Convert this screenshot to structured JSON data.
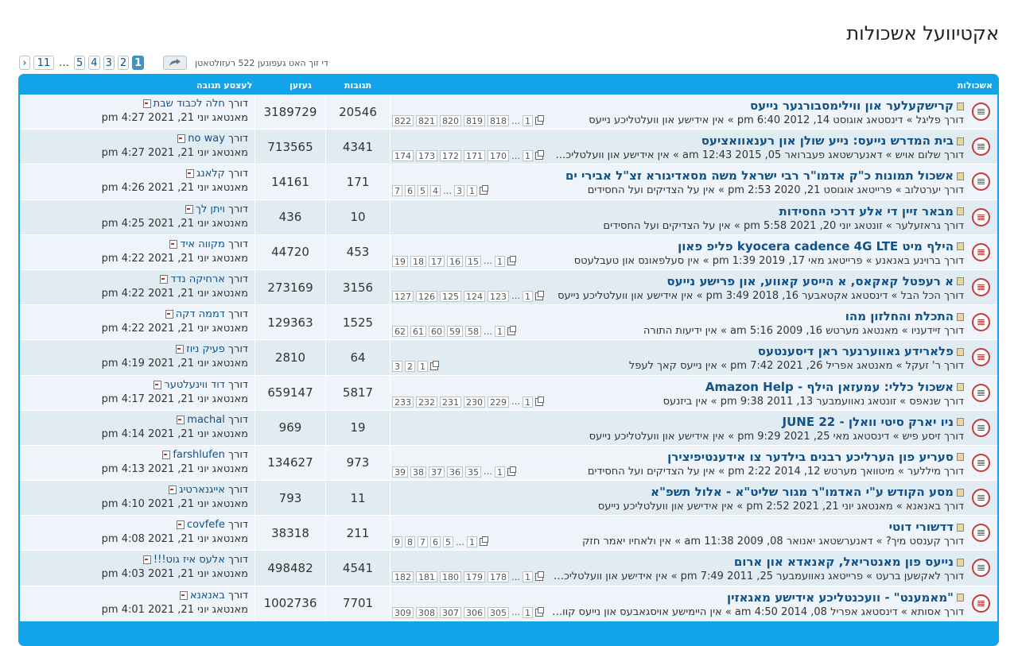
{
  "page": {
    "title": "אקטיוועל אשכולות"
  },
  "pager": {
    "stats": "די זוך האט געפונען 522 רעזולטאטן",
    "pages": [
      "1",
      "2",
      "3",
      "4",
      "5",
      "…",
      "11"
    ],
    "current": "1",
    "next": "›"
  },
  "table": {
    "headers": {
      "topics": "אשכולות",
      "replies": "תגובות",
      "views": "געזען",
      "last": "לעצטע תגובה"
    },
    "rows": [
      {
        "title": "קרישקעלער און ווילימסבורגער נייעס",
        "meta": "דורך פליגל » דינסטאג אוגוסט 14, 2012 6:40 pm » אין אידישע און וועלטליכע נייעס",
        "pages": [
          "822",
          "821",
          "820",
          "819",
          "818",
          "…",
          "1"
        ],
        "replies": "20546",
        "views": "3189729",
        "last_by": "דורך",
        "last_user": "חלה לכבוד שבת",
        "last_date": "מאנטאג יוני 21, 2021 4:27 pm"
      },
      {
        "title": "בית המדרש נייעס: נייע שולן און רענאוואציעס",
        "meta": "דורך שלום אויש » דאנערשטאג פעברואר 05, 2015 12:43 am » אין אידישע און וועלטליכע נ...",
        "pages": [
          "174",
          "173",
          "172",
          "171",
          "170",
          "…",
          "1"
        ],
        "replies": "4341",
        "views": "713565",
        "last_by": "דורך",
        "last_user": "no way",
        "last_date": "מאנטאג יוני 21, 2021 4:27 pm"
      },
      {
        "title": "אשכול תמונות כ\"ק אדמו\"ר רבי ישראל משה מסאדיגורא זצ\"ל אבירי ים",
        "meta": "דורך יערטלוב » פרייטאג אוגוסט 21, 2020 2:53 pm » אין על הצדיקים ועל החסידים",
        "pages": [
          "7",
          "6",
          "5",
          "4",
          "…",
          "3",
          "1"
        ],
        "replies": "171",
        "views": "14161",
        "last_by": "דורך",
        "last_user": "קלאנג",
        "last_date": "מאנטאג יוני 21, 2021 4:26 pm"
      },
      {
        "title": "מבאר זיין די אלע דרכי החסידות",
        "meta": "דורך גראזעלער » זונטאג יוני 20, 2021 5:58 pm » אין על הצדיקים ועל החסידים",
        "pages": [],
        "replies": "10",
        "views": "436",
        "last_by": "דורך",
        "last_user": "ויתן לך",
        "last_date": "מאנטאג יוני 21, 2021 4:25 pm"
      },
      {
        "title": "הילף מיט kyocera cadence 4G LTE פליפ פאון",
        "meta": "דורך ברוינע באנאנע » פרייטאג מאי 17, 2019 1:39 pm » אין סעלפאונס און טעבלעטס",
        "pages": [
          "19",
          "18",
          "17",
          "16",
          "15",
          "…",
          "1"
        ],
        "replies": "453",
        "views": "44720",
        "last_by": "דורך",
        "last_user": "מקווה איד",
        "last_date": "מאנטאג יוני 21, 2021 4:22 pm"
      },
      {
        "title": "א רעפטל קאקאס, א הייסע קאווע, און פרישע נייעס",
        "meta": "דורך הכל הבל » דינסטאג אקטאבער 16, 2018 3:49 pm » אין אידישע און וועלטליכע נייעס",
        "pages": [
          "127",
          "126",
          "125",
          "124",
          "123",
          "…",
          "1"
        ],
        "replies": "3156",
        "views": "273169",
        "last_by": "דורך",
        "last_user": "ארחיקה נדד",
        "last_date": "מאנטאג יוני 21, 2021 4:22 pm"
      },
      {
        "title": "התכלת והחלזון מהו",
        "meta": "דורך זיידעניו » מאנטאג מערטש 16, 2009 5:16 am » אין ידיעות התורה",
        "pages": [
          "62",
          "61",
          "60",
          "59",
          "58",
          "…",
          "1"
        ],
        "replies": "1525",
        "views": "129363",
        "last_by": "דורך",
        "last_user": "דממה דקה",
        "last_date": "מאנטאג יוני 21, 2021 4:22 pm"
      },
      {
        "title": "פלארידע גאווערנער ראן דיסענטעס",
        "meta": "דורך ר' זעקל » מאנטאג אפריל 26, 2021 7:42 pm » אין נייעס קאך לעפל",
        "pages": [
          "3",
          "2",
          "1"
        ],
        "replies": "64",
        "views": "2810",
        "last_by": "דורך",
        "last_user": "פעיק ניוז",
        "last_date": "מאנטאג יוני 21, 2021 4:19 pm"
      },
      {
        "title": "אשכול כללי: עמעזאן הילף - Amazon Help",
        "meta": "דורך שנאפס » זונטאג נאוועמבער 13, 2011 9:38 pm » אין ביזנעס",
        "pages": [
          "233",
          "232",
          "231",
          "230",
          "229",
          "…",
          "1"
        ],
        "replies": "5817",
        "views": "659147",
        "last_by": "דורך",
        "last_user": "דוד ווינעלטער",
        "last_date": "מאנטאג יוני 21, 2021 4:17 pm"
      },
      {
        "title": "ניו יארק סיטי וואלן - JUNE 22",
        "meta": "דורך זיסע פיש » דינסטאג מאי 25, 2021 9:29 pm » אין אידישע און וועלטליכע נייעס",
        "pages": [],
        "replies": "19",
        "views": "969",
        "last_by": "דורך",
        "last_user": "machal",
        "last_date": "מאנטאג יוני 21, 2021 4:14 pm"
      },
      {
        "title": "סעריע פון הערליכע רבנים בילדער צו אידענטיפיצירן",
        "meta": "דורך מיללער » מיטוואך מערטש 12, 2014 2:22 pm » אין על הצדיקים ועל החסידים",
        "pages": [
          "39",
          "38",
          "37",
          "36",
          "35",
          "…",
          "1"
        ],
        "replies": "973",
        "views": "134627",
        "last_by": "דורך",
        "last_user": "farshlufen",
        "last_date": "מאנטאג יוני 21, 2021 4:13 pm"
      },
      {
        "title": "מסע הקודש ע\"י האדמו\"ר מגור שליט\"א - אלול תשפ\"א",
        "meta": "דורך באנאנא » מאנטאג יוני 21, 2021 2:52 pm » אין אידישע און וועלטליכע נייעס",
        "pages": [],
        "replies": "11",
        "views": "793",
        "last_by": "דורך",
        "last_user": "אייגנארטיג",
        "last_date": "מאנטאג יוני 21, 2021 4:10 pm"
      },
      {
        "title": "דדשורי דוטי",
        "meta": "דורך קענסט מיך? » דאנערשטאג יאנואר 08, 2009 11:38 am » אין ולאחיו יאמר חזק",
        "pages": [
          "9",
          "8",
          "7",
          "6",
          "5",
          "…",
          "1"
        ],
        "replies": "211",
        "views": "38318",
        "last_by": "דורך",
        "last_user": "covfefe",
        "last_date": "מאנטאג יוני 21, 2021 4:08 pm"
      },
      {
        "title": "נייעס פון מאנטריאל, קאנאדא און ארום",
        "meta": "דורך לאקשען ברעט » פרייטאג נאוועמבער 25, 2011 7:49 pm » אין אידישע און וועלטליכע ניי...",
        "pages": [
          "182",
          "181",
          "180",
          "179",
          "178",
          "…",
          "1"
        ],
        "replies": "4541",
        "views": "498482",
        "last_by": "דורך",
        "last_user": "אלעס איז גוט!!!",
        "last_date": "מאנטאג יוני 21, 2021 4:03 pm"
      },
      {
        "title": "\"מאמענט\" - וועכנטליכע אידישע מאגאזין",
        "meta": "דורך אסותא » דינסטאג אפריל 08, 2014 4:50 am » אין היימישע אויסגאבעס און נייעס קוועל...",
        "pages": [
          "309",
          "308",
          "307",
          "306",
          "305",
          "…",
          "1"
        ],
        "replies": "7701",
        "views": "1002736",
        "last_by": "דורך",
        "last_user": "באנאנא",
        "last_date": "מאנטאג יוני 21, 2021 4:01 pm"
      }
    ]
  }
}
